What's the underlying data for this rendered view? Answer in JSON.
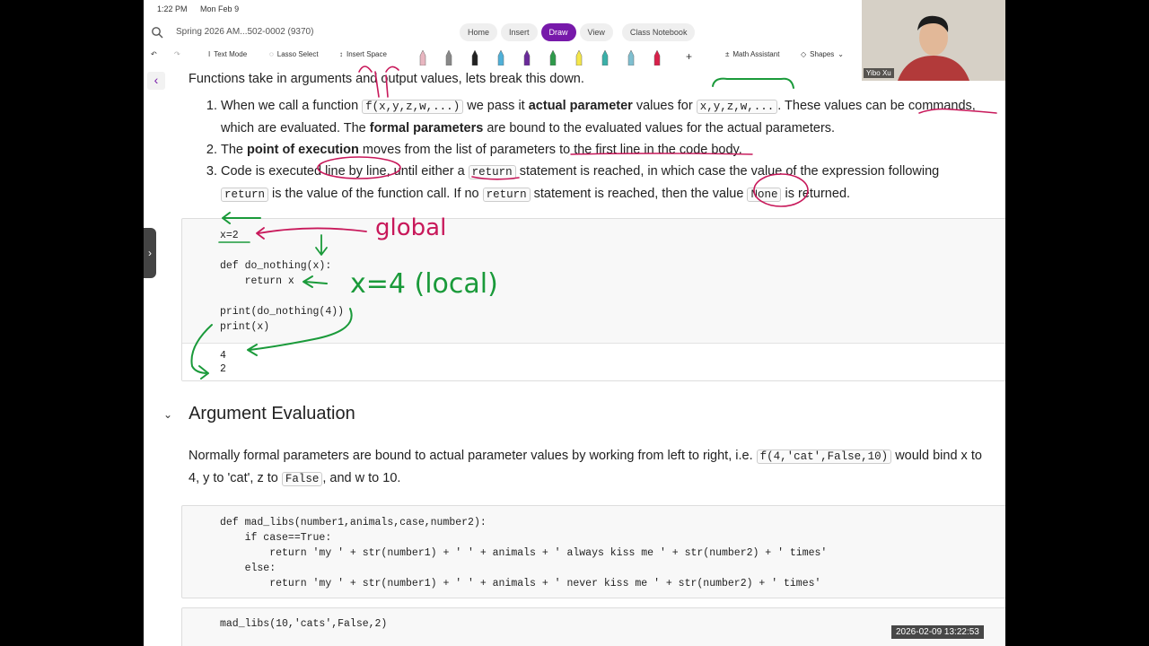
{
  "status": {
    "time": "1:22 PM",
    "date": "Mon Feb 9"
  },
  "title": {
    "notebook": "Spring 2026 AM...502-0002 (9370)"
  },
  "tabs": [
    "Home",
    "Insert",
    "Draw",
    "View",
    "Class Notebook"
  ],
  "toolbar": {
    "text_mode": "Text Mode",
    "lasso": "Lasso Select",
    "insert_space": "Insert Space",
    "math": "Math Assistant",
    "shapes": "Shapes"
  },
  "pens": [
    "#e8b6c0",
    "#888888",
    "#222222",
    "#4fb0d8",
    "#6a2a9a",
    "#2e9a4a",
    "#f4e64a",
    "#3ab0a8",
    "#7fbfd0",
    "#d8204a"
  ],
  "intro": "Functions take in arguments and output values, lets break this down.",
  "steps": {
    "s1_a": "When we call a function ",
    "s1_code1": "f(x,y,z,w,...)",
    "s1_b": " we pass it ",
    "s1_bold1": "actual parameter",
    "s1_c": " values for ",
    "s1_code2": "x,y,z,w,...",
    "s1_d": ". These values can be ",
    "s1_e": "commands",
    "s1_f": ", which are evaluated. The ",
    "s1_bold2": "formal parameters",
    "s1_g": " are bound to the evaluated values for the actual parameters.",
    "s2_a": "The ",
    "s2_bold": "point of execution",
    "s2_b": " moves from the list of parameters to the first line in the code body.",
    "s3_a": "Code is executed line by line, until either a ",
    "s3_code1": "return",
    "s3_b": " statement is reached, in which case the value of the expression following ",
    "s3_code2": "return",
    "s3_c": " is the value of the function call. If no ",
    "s3_code3": "return",
    "s3_d": " statement is reached, then the value ",
    "s3_code4": "None",
    "s3_e": " is returned."
  },
  "cell1": {
    "code": "x=2\n\ndef do_nothing(x):\n    return x\n\nprint(do_nothing(4))\nprint(x)",
    "output": "4\n2"
  },
  "ink": {
    "global": "global",
    "local": "x=4 (local)"
  },
  "section": {
    "title": "Argument Evaluation"
  },
  "para": {
    "a": "Normally formal parameters are bound to actual parameter values by working from left to right, i.e. ",
    "code1": "f(4,'cat',False,10)",
    "b": " would bind x to 4, y to 'cat', z to ",
    "code2": "False",
    "c": ", and w to 10."
  },
  "cell2": {
    "code": "def mad_libs(number1,animals,case,number2):\n    if case==True:\n        return 'my ' + str(number1) + ' ' + animals + ' always kiss me ' + str(number2) + ' times'\n    else:\n        return 'my ' + str(number1) + ' ' + animals + ' never kiss me ' + str(number2) + ' times'"
  },
  "cell3": {
    "code": "mad_libs(10,'cats',False,2)"
  },
  "webcam": {
    "name": "Yibo Xu"
  },
  "timestamp": "2026-02-09  13:22:53",
  "colors": {
    "accent": "#7719aa",
    "ink_green": "#1a9a3a",
    "ink_red": "#c8185a"
  }
}
